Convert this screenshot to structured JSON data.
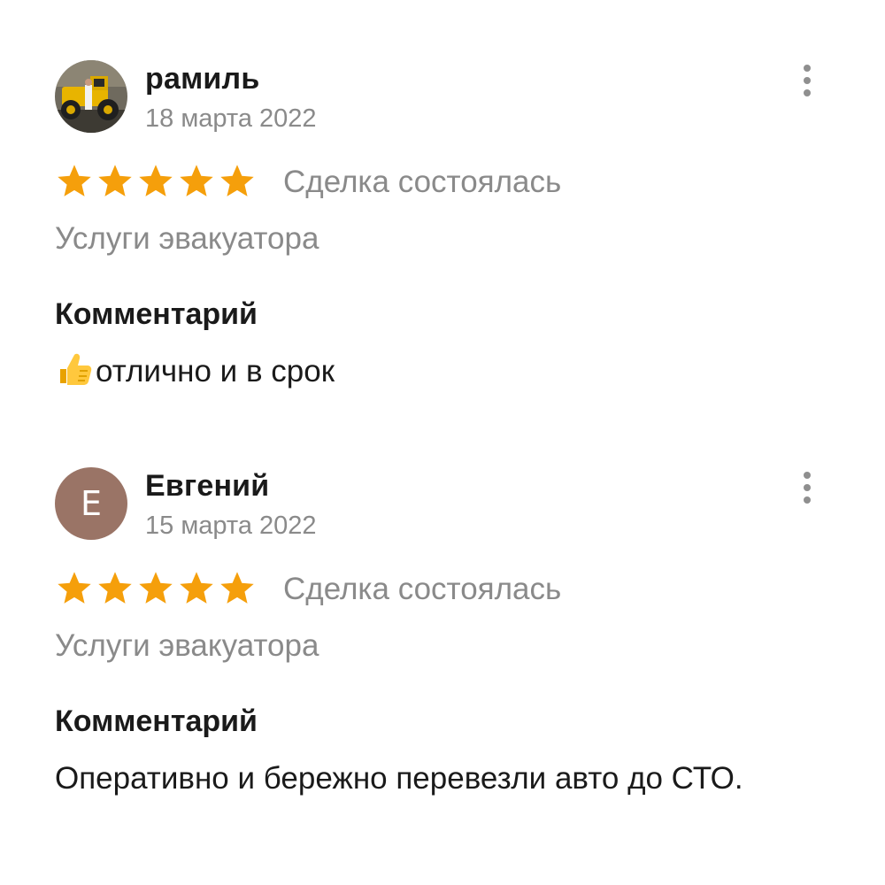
{
  "reviews": [
    {
      "author": "рамиль",
      "date": "18 марта 2022",
      "avatar": {
        "type": "photo",
        "icon": "avatar-photo-loader-icon"
      },
      "rating": 5,
      "rating_max": 5,
      "deal_status": "Сделка состоялась",
      "service": "Услуги эвакуатора",
      "comment_heading": "Комментарий",
      "comment_emoji": "thumbs-up-icon",
      "comment": "отлично и в срок"
    },
    {
      "author": "Евгений",
      "date": "15 марта 2022",
      "avatar": {
        "type": "letter",
        "letter": "Е",
        "color": "#9a7466"
      },
      "rating": 5,
      "rating_max": 5,
      "deal_status": "Сделка состоялась",
      "service": "Услуги эвакуатора",
      "comment_heading": "Комментарий",
      "comment": "Оперативно и бережно перевезли авто до СТО."
    }
  ],
  "colors": {
    "star": "#f59f0b",
    "muted_text": "#8a8a8a",
    "primary_text": "#1a1a1a",
    "menu_dots": "#8f8f8f"
  },
  "icons": {
    "menu": "more-vertical-icon",
    "star": "star-icon"
  }
}
